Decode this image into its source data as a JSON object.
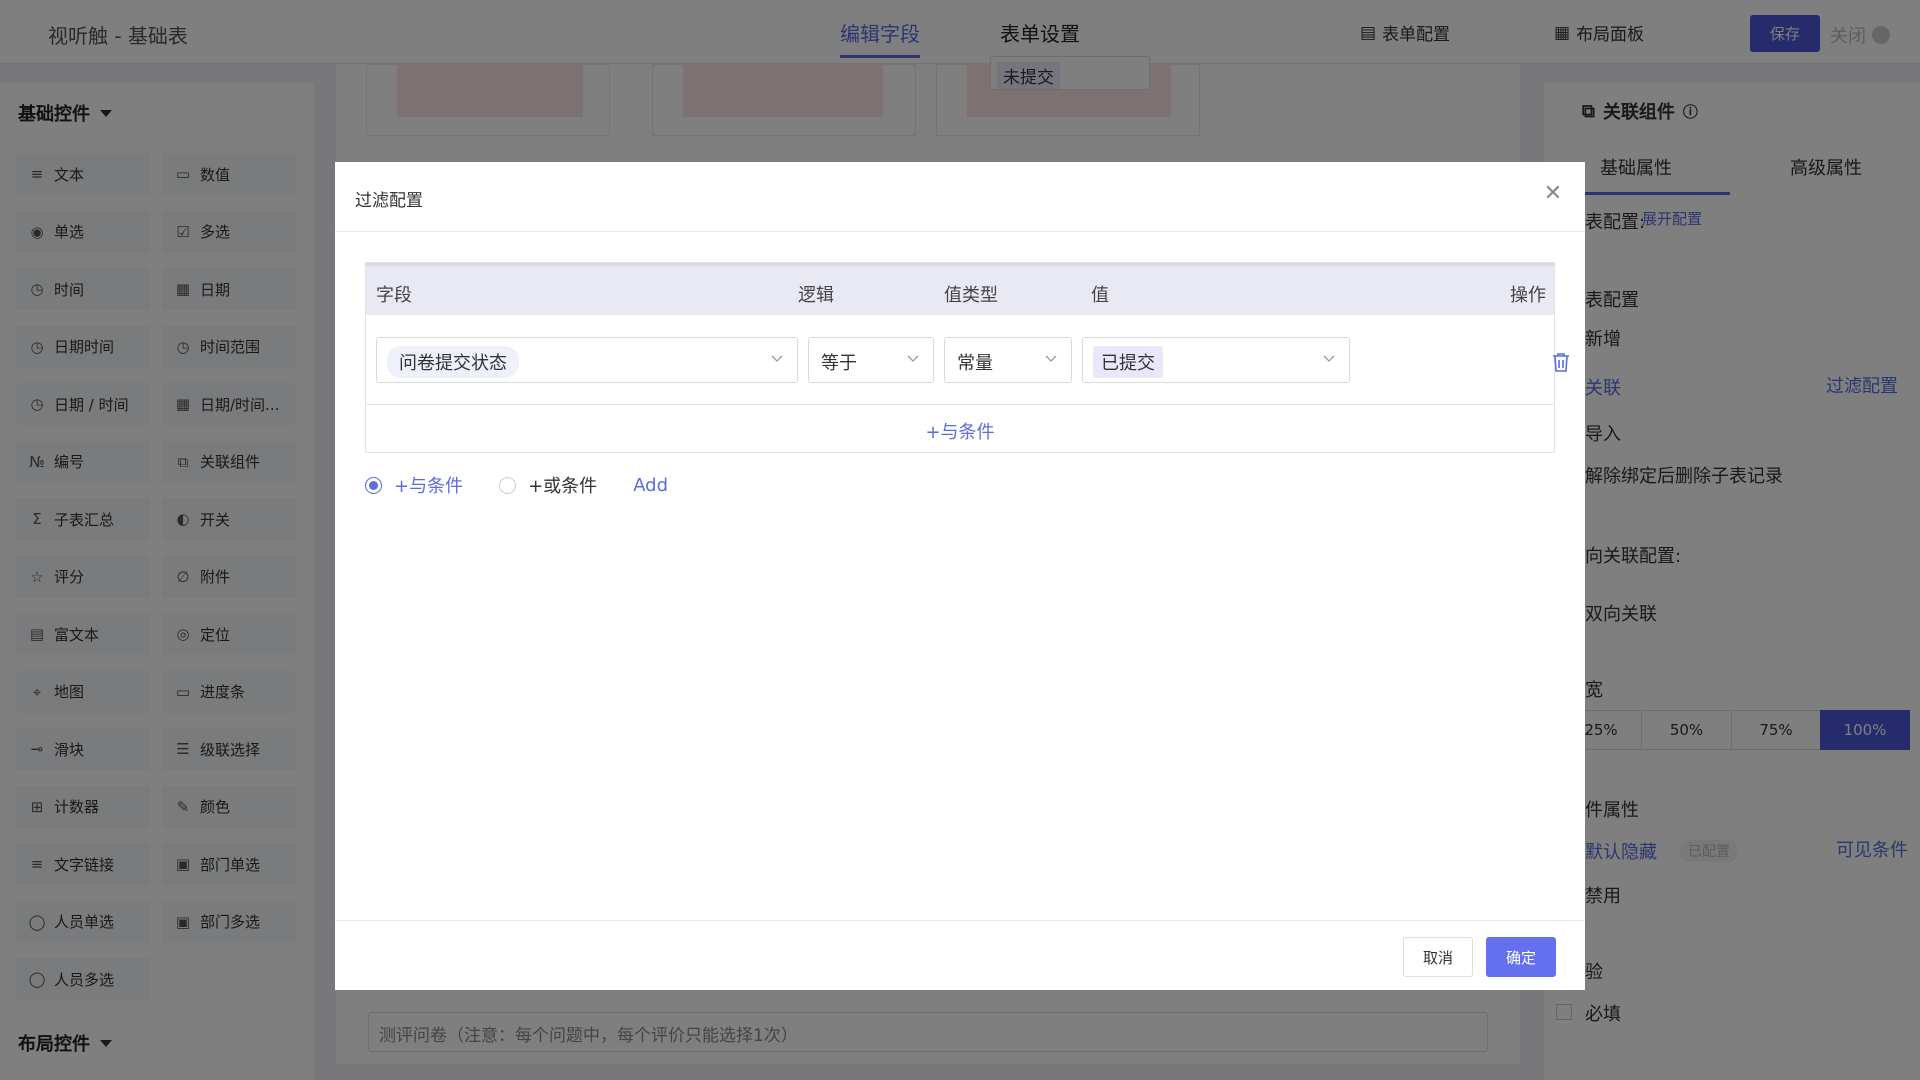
{
  "topbar": {
    "app_title": "视听触 - 基础表",
    "tabs": [
      "编辑字段",
      "表单设置"
    ],
    "form_config": "表单配置",
    "layout_panel": "布局面板",
    "save": "保存",
    "close": "关闭"
  },
  "palette": {
    "basic_group": "基础控件",
    "layout_group": "布局控件",
    "widgets": [
      {
        "label": "文本",
        "icon": "text-icon"
      },
      {
        "label": "数值",
        "icon": "number-icon"
      },
      {
        "label": "单选",
        "icon": "radio-icon"
      },
      {
        "label": "多选",
        "icon": "checkbox-icon"
      },
      {
        "label": "时间",
        "icon": "clock-icon"
      },
      {
        "label": "日期",
        "icon": "calendar-icon"
      },
      {
        "label": "日期时间",
        "icon": "clock-icon"
      },
      {
        "label": "时间范围",
        "icon": "clock-icon"
      },
      {
        "label": "日期 / 时间",
        "icon": "clock-icon"
      },
      {
        "label": "日期/时间...",
        "icon": "calendar-icon"
      },
      {
        "label": "编号",
        "icon": "serial-icon"
      },
      {
        "label": "关联组件",
        "icon": "link-component-icon"
      },
      {
        "label": "子表汇总",
        "icon": "sigma-icon"
      },
      {
        "label": "开关",
        "icon": "toggle-icon"
      },
      {
        "label": "评分",
        "icon": "star-icon"
      },
      {
        "label": "附件",
        "icon": "paperclip-icon"
      },
      {
        "label": "富文本",
        "icon": "rich-text-icon"
      },
      {
        "label": "定位",
        "icon": "location-icon"
      },
      {
        "label": "地图",
        "icon": "map-icon"
      },
      {
        "label": "进度条",
        "icon": "progress-icon"
      },
      {
        "label": "滑块",
        "icon": "slider-icon"
      },
      {
        "label": "级联选择",
        "icon": "cascade-icon"
      },
      {
        "label": "计数器",
        "icon": "counter-icon"
      },
      {
        "label": "颜色",
        "icon": "color-picker-icon"
      },
      {
        "label": "文字链接",
        "icon": "text-link-icon"
      },
      {
        "label": "部门单选",
        "icon": "dept-icon"
      },
      {
        "label": "人员单选",
        "icon": "user-icon"
      },
      {
        "label": "部门多选",
        "icon": "dept-icon"
      },
      {
        "label": "人员多选",
        "icon": "users-icon"
      }
    ]
  },
  "canvas": {
    "status_value": "未提交",
    "bottom_field": "测评问卷（注意：每个问题中，每个评价只能选择1次）"
  },
  "props": {
    "title": "关联组件",
    "tabs": [
      "基础属性",
      "高级属性"
    ],
    "config_label": "表配置:",
    "expand_link": "展开配置",
    "section_config": "表配置",
    "add": "新增",
    "relate": "关联",
    "filter_config": "过滤配置",
    "import": "导入",
    "unbind_delete": "解除绑定后删除子表记录",
    "reverse_config": "向关联配置:",
    "two_way": "双向关联",
    "width_label": "宽",
    "widths": [
      "25%",
      "50%",
      "75%",
      "100%"
    ],
    "width_selected": "100%",
    "attr_label": "件属性",
    "default_hidden": "默认隐藏",
    "configured": "已配置",
    "visible_cond": "可见条件",
    "disabled": "禁用",
    "check_label": "验",
    "required": "必填"
  },
  "modal": {
    "title": "过滤配置",
    "columns": [
      "字段",
      "逻辑",
      "值类型",
      "值",
      "操作"
    ],
    "row": {
      "field": "问卷提交状态",
      "logic": "等于",
      "value_type": "常量",
      "value": "已提交"
    },
    "add_and": "+与条件",
    "radio_and": "+与条件",
    "radio_or": "+或条件",
    "add": "Add",
    "cancel": "取消",
    "confirm": "确定"
  },
  "colors": {
    "accent": "#5b6be0",
    "primary_button": "#4a56d6",
    "overlay": "rgba(0,0,0,0.5)"
  }
}
